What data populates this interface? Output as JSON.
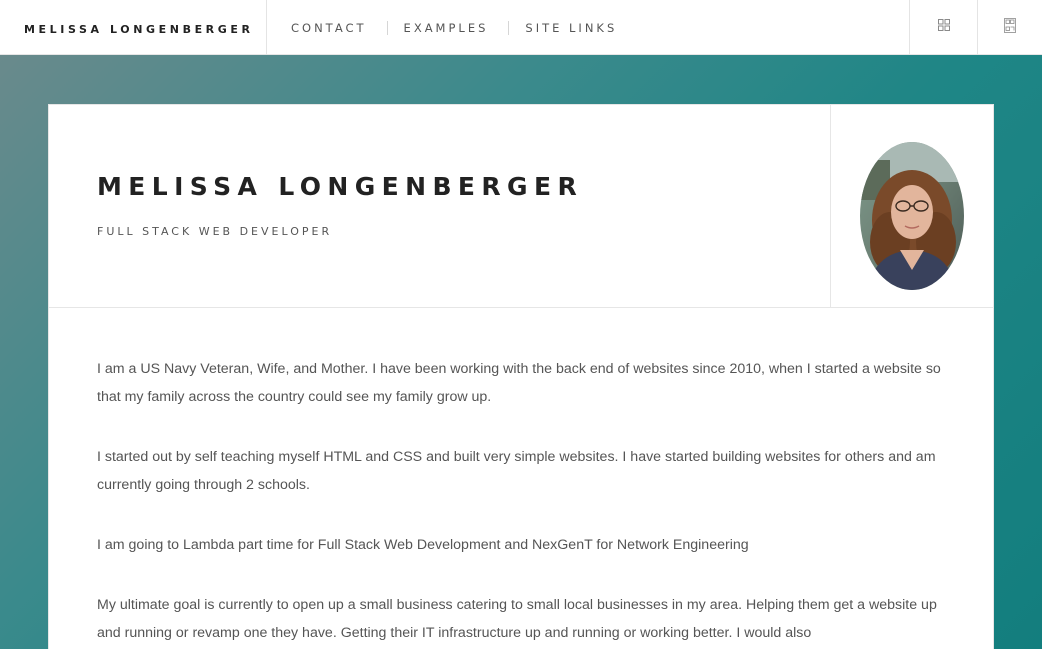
{
  "nav": {
    "brand": "MELISSA LONGENBERGER",
    "links": [
      "CONTACT",
      "EXAMPLES",
      "SITE LINKS"
    ],
    "icons": [
      "grid-icon",
      "qr-code-icon"
    ]
  },
  "profile": {
    "name": "MELISSA LONGENBERGER",
    "subtitle": "FULL STACK WEB DEVELOPER",
    "avatar_icon": "profile-photo"
  },
  "about": {
    "paragraphs": [
      "I am a US Navy Veteran, Wife, and Mother. I have been working with the back end of websites since 2010, when I started a website so that my family across the country could see my family grow up.",
      "I started out by self teaching myself HTML and CSS and built very simple websites. I have started building websites for others and am currently going through 2 schools.",
      "I am going to Lambda part time for Full Stack Web Development and NexGenT for Network Engineering",
      "My ultimate goal is currently to open up a small business catering to small local businesses in my area. Helping them get a website up and running or revamp one they have. Getting their IT infrastructure up and running or working better. I would also"
    ]
  },
  "colors": {
    "background_start": "#6e8a8c",
    "background_end": "#137e7e",
    "card": "#ffffff",
    "text_dark": "#222222",
    "text_body": "#555555"
  }
}
